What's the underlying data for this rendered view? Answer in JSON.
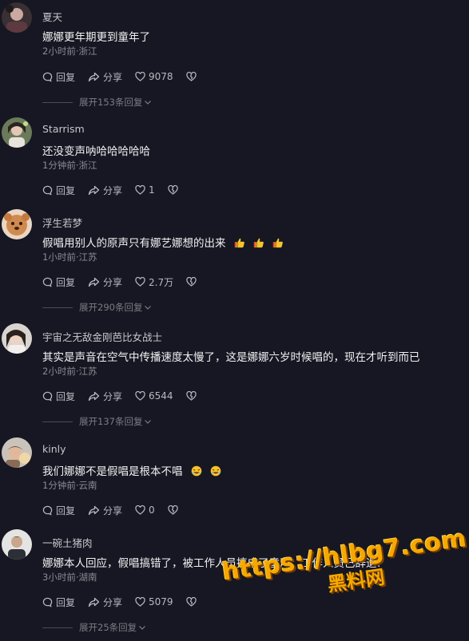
{
  "comments": [
    {
      "username": "夏天",
      "text": "娜娜更年期更到童年了",
      "meta": "2小时前·浙江",
      "reply": "回复",
      "share": "分享",
      "likes": "9078",
      "expand": "展开153条回复",
      "emoji_count": 0
    },
    {
      "username": "Starrism",
      "text": "还没变声呐哈哈哈哈哈",
      "meta": "1分钟前·浙江",
      "reply": "回复",
      "share": "分享",
      "likes": "1",
      "expand": "",
      "emoji_count": 0
    },
    {
      "username": "浮生若梦",
      "text": "假唱用别人的原声只有娜艺娜想的出来",
      "meta": "1小时前·江苏",
      "reply": "回复",
      "share": "分享",
      "likes": "2.7万",
      "expand": "展开290条回复",
      "emoji": "thumbs-up",
      "emoji_count": 3
    },
    {
      "username": "宇宙之无敌金刚芭比女战士",
      "text": "其实是声音在空气中传播速度太慢了，这是娜娜六岁时候唱的，现在才听到而已",
      "meta": "2小时前·江苏",
      "reply": "回复",
      "share": "分享",
      "likes": "6544",
      "expand": "展开137条回复",
      "emoji_count": 0
    },
    {
      "username": "kinly",
      "text": "我们娜娜不是假唱是根本不唱",
      "meta": "1分钟前·云南",
      "reply": "回复",
      "share": "分享",
      "likes": "0",
      "expand": "",
      "emoji": "laughing-face",
      "emoji_count": 2
    },
    {
      "username": "一碗土猪肉",
      "text": "娜娜本人回应，假唱搞错了，被工作人员搞成了童声，工作人员已辞退!",
      "meta": "3小时前·湖南",
      "reply": "回复",
      "share": "分享",
      "likes": "5079",
      "expand": "展开25条回复",
      "emoji_count": 0
    }
  ],
  "watermark": {
    "line1": "https://hlbg7.com",
    "line2": "黑料网"
  },
  "colors": {
    "background": "#161722",
    "watermark": "#f5a800"
  }
}
